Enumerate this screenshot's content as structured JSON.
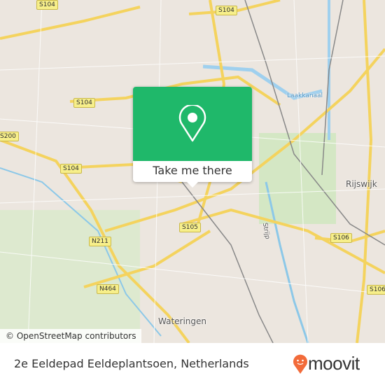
{
  "map": {
    "road_labels": [
      "S104",
      "S104",
      "S104",
      "S104",
      "S200",
      "S105",
      "S106",
      "S106",
      "N211",
      "N464"
    ],
    "places": [
      "Rijswijk",
      "Wateringen"
    ],
    "water_labels": [
      "Laakkanaal",
      "Strijp"
    ],
    "attribution": "© OpenStreetMap contributors"
  },
  "popup": {
    "icon": "map-pin-icon",
    "button_label": "Take me there",
    "color": "#1fb86a"
  },
  "footer": {
    "address": "2e Eeldepad Eeldeplantsoen, Netherlands",
    "brand": "moovit",
    "brand_color": "#f26b3a"
  }
}
